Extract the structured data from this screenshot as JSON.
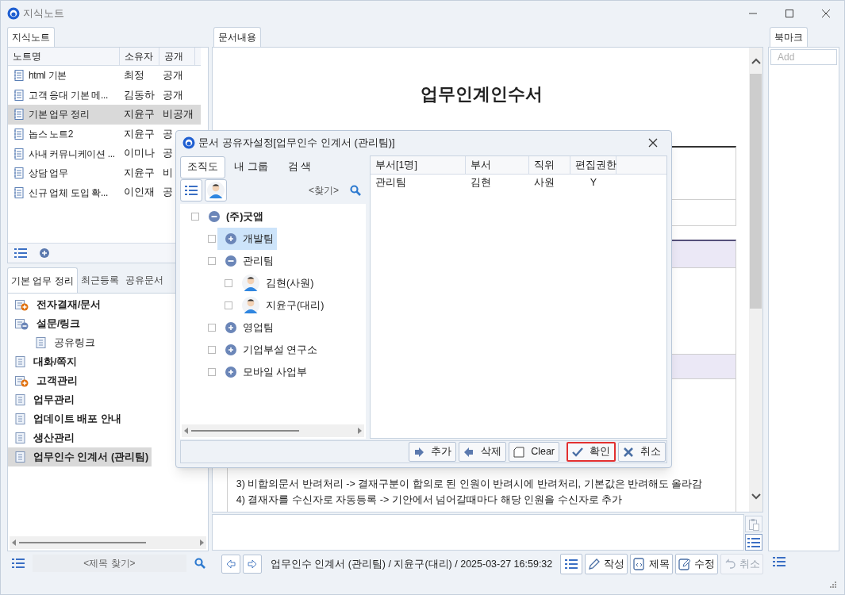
{
  "window": {
    "title": "지식노트"
  },
  "notes_panel": {
    "tab": "지식노트",
    "columns": [
      "노트명",
      "소유자",
      "공개"
    ],
    "rows": [
      {
        "name": "html 기본",
        "owner": "최정",
        "visibility": "공개",
        "selected": false
      },
      {
        "name": "고객 응대 기본 메...",
        "owner": "김동하",
        "visibility": "공개",
        "selected": false
      },
      {
        "name": "기본 업무 정리",
        "owner": "지윤구",
        "visibility": "비공개",
        "selected": true
      },
      {
        "name": "놉스 노트2",
        "owner": "지윤구",
        "visibility": "공",
        "selected": false
      },
      {
        "name": "사내 커뮤니케이션 ...",
        "owner": "이미나",
        "visibility": "공",
        "selected": false
      },
      {
        "name": "상담 업무",
        "owner": "지윤구",
        "visibility": "비",
        "selected": false
      },
      {
        "name": "신규 업체 도입 확...",
        "owner": "이인재",
        "visibility": "공",
        "selected": false
      }
    ]
  },
  "category_panel": {
    "tabs": [
      {
        "label": "기본 업무 정리",
        "selected": true
      },
      {
        "label": "최근등록",
        "selected": false
      },
      {
        "label": "공유문서",
        "selected": false
      }
    ],
    "tree": [
      {
        "label": "전자결재/문서",
        "kind": "folder",
        "expanded": false,
        "selected": false
      },
      {
        "label": "설문/링크",
        "kind": "folder",
        "expanded": true,
        "selected": false,
        "children": [
          {
            "label": "공유링크",
            "kind": "document",
            "selected": false
          }
        ]
      },
      {
        "label": "대화/쪽지",
        "kind": "document",
        "selected": false
      },
      {
        "label": "고객관리",
        "kind": "folder",
        "expanded": false,
        "selected": false
      },
      {
        "label": "업무관리",
        "kind": "document",
        "selected": false
      },
      {
        "label": "업데이트 배포 안내",
        "kind": "document",
        "selected": false
      },
      {
        "label": "생산관리",
        "kind": "document",
        "selected": false
      },
      {
        "label": "업무인수 인계서 (관리팀)",
        "kind": "document",
        "selected": true
      }
    ],
    "search": {
      "placeholder": "<제목 찾기>"
    }
  },
  "document": {
    "tab": "문서내용",
    "title": "업무인계인수서",
    "lines": [
      "3) 비합의문서 반려처리 -> 결재구분이 합의로 된 인원이 반려시에 반려처리, 기본값은 반려해도 올라감",
      "4) 결재자를 수신자로 자동등록 -> 기안에서 넘어갈때마다 해당 인원을 수신자로 추가"
    ]
  },
  "status": "업무인수 인계서 (관리팀) / 지윤구(대리) / 2025-03-27 16:59:32",
  "toolbar": [
    {
      "label": "작성",
      "kind": "write",
      "disabled": false
    },
    {
      "label": "제목",
      "kind": "title",
      "disabled": false
    },
    {
      "label": "수정",
      "kind": "edit",
      "disabled": false
    },
    {
      "label": "취소",
      "kind": "undo",
      "disabled": true
    }
  ],
  "bookmark": {
    "tab": "북마크",
    "placeholder": "Add"
  },
  "dialog": {
    "title": "문서 공유자설정[업무인수 인계서 (관리팀)]",
    "tabs": [
      {
        "label": "조직도",
        "selected": true
      },
      {
        "label": "내 그룹",
        "selected": false
      },
      {
        "label": "검 색",
        "selected": false
      }
    ],
    "search": {
      "placeholder": "<찾기>"
    },
    "tree": [
      {
        "label": "(주)굿앱",
        "kind": "group",
        "expanded": true,
        "checked": false,
        "selected": false,
        "children": [
          {
            "label": "개발팀",
            "kind": "group",
            "expanded": false,
            "checked": false,
            "selected": true
          },
          {
            "label": "관리팀",
            "kind": "group",
            "expanded": true,
            "checked": false,
            "selected": false,
            "children": [
              {
                "label": "김현(사원)",
                "kind": "person",
                "checked": false,
                "selected": false
              },
              {
                "label": "지윤구(대리)",
                "kind": "person",
                "checked": false,
                "selected": false
              }
            ]
          },
          {
            "label": "영업팀",
            "kind": "group",
            "expanded": false,
            "checked": false,
            "selected": false
          },
          {
            "label": "기업부설 연구소",
            "kind": "group",
            "expanded": false,
            "checked": false,
            "selected": false
          },
          {
            "label": "모바일 사업부",
            "kind": "group",
            "expanded": false,
            "checked": false,
            "selected": false
          }
        ]
      }
    ],
    "table": {
      "columns": [
        "부서[1명]",
        "부서",
        "직위",
        "편집권한"
      ],
      "rows": [
        [
          "관리팀",
          "김현",
          "사원",
          "Y"
        ]
      ]
    },
    "buttons": [
      {
        "label": "추가",
        "kind": "add",
        "highlighted": false
      },
      {
        "label": "삭제",
        "kind": "remove",
        "highlighted": false
      },
      {
        "label": "Clear",
        "kind": "clear",
        "highlighted": false
      },
      {
        "label": "확인",
        "kind": "ok",
        "highlighted": true
      },
      {
        "label": "취소",
        "kind": "cancel",
        "highlighted": false
      }
    ]
  }
}
